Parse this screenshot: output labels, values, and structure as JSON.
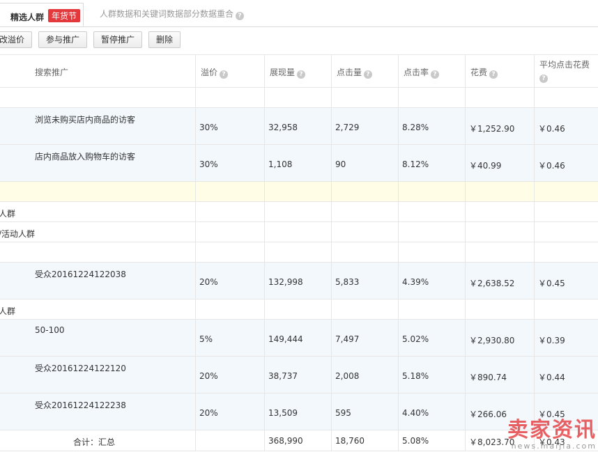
{
  "tabs": {
    "active_label": "精选人群",
    "badge": "年货节",
    "notice": "人群数据和关键词数据部分数据重合"
  },
  "toolbar": {
    "buttons": [
      "改溢价",
      "参与推广",
      "暂停推广",
      "删除"
    ]
  },
  "table": {
    "columns": [
      "搜索推广",
      "溢价",
      "展现量",
      "点击量",
      "点击率",
      "花费",
      "平均点击花费"
    ],
    "rows": [
      {
        "kind": "group",
        "label": "",
        "cells": [
          "",
          "",
          "",
          "",
          "",
          ""
        ]
      },
      {
        "kind": "data",
        "label": "浏览未购买店内商品的访客",
        "cells": [
          "30%",
          "32,958",
          "2,729",
          "8.28%",
          "￥1,252.90",
          "￥0.46"
        ]
      },
      {
        "kind": "data",
        "label": "店内商品放入购物车的访客",
        "cells": [
          "30%",
          "1,108",
          "90",
          "8.12%",
          "￥40.99",
          "￥0.46"
        ]
      },
      {
        "kind": "highlight",
        "label": "",
        "cells": [
          "",
          "",
          "",
          "",
          "",
          ""
        ]
      },
      {
        "kind": "group",
        "label": "人群",
        "cells": [
          "",
          "",
          "",
          "",
          "",
          ""
        ]
      },
      {
        "kind": "group",
        "label": "/活动人群",
        "cells": [
          "",
          "",
          "",
          "",
          "",
          ""
        ]
      },
      {
        "kind": "group",
        "label": "",
        "cells": [
          "",
          "",
          "",
          "",
          "",
          ""
        ]
      },
      {
        "kind": "data",
        "label": "受众20161224122038",
        "cells": [
          "20%",
          "132,998",
          "5,833",
          "4.39%",
          "￥2,638.52",
          "￥0.45"
        ]
      },
      {
        "kind": "group",
        "label": "人群",
        "cells": [
          "",
          "",
          "",
          "",
          "",
          ""
        ]
      },
      {
        "kind": "data",
        "label": "50-100",
        "cells": [
          "5%",
          "149,444",
          "7,497",
          "5.02%",
          "￥2,930.80",
          "￥0.39"
        ]
      },
      {
        "kind": "data",
        "label": "受众20161224122120",
        "cells": [
          "20%",
          "38,737",
          "2,008",
          "5.18%",
          "￥890.74",
          "￥0.44"
        ]
      },
      {
        "kind": "data",
        "label": "受众20161224122238",
        "cells": [
          "20%",
          "13,509",
          "595",
          "4.40%",
          "￥266.06",
          "￥0.45"
        ]
      }
    ],
    "total": {
      "label": "合计：汇总",
      "cells": [
        "",
        "368,990",
        "18,760",
        "5.08%",
        "￥8,023.70",
        "￥0.43"
      ]
    }
  },
  "watermark": {
    "text": "卖家资讯",
    "url": "news.maijia.com"
  }
}
